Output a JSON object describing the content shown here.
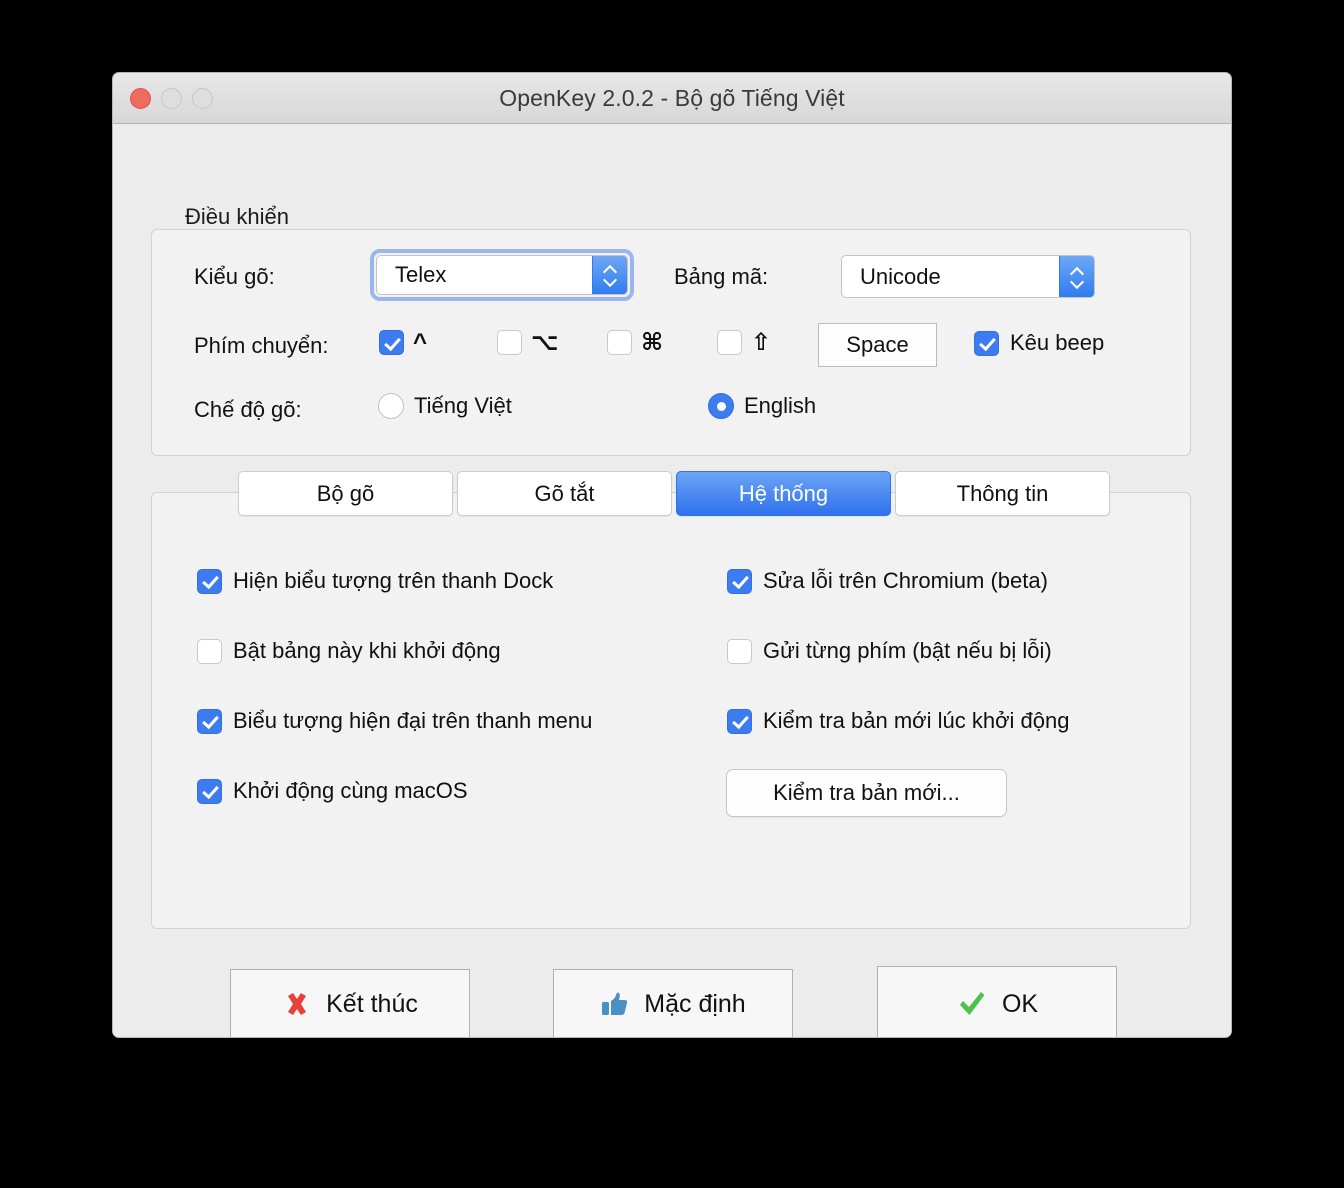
{
  "window": {
    "title": "OpenKey 2.0.2 - Bộ gõ Tiếng Việt",
    "traffic": {
      "close": "close-button",
      "minimize": "minimize-button",
      "maximize": "maximize-button"
    }
  },
  "control_group": {
    "legend": "Điều khiển",
    "input_method": {
      "label": "Kiểu gõ:",
      "value": "Telex",
      "focused": true
    },
    "charset": {
      "label": "Bảng mã:",
      "value": "Unicode",
      "focused": false
    },
    "switch_key": {
      "label": "Phím chuyển:",
      "modifiers": [
        {
          "glyph": "^",
          "name": "control-key",
          "checked": true
        },
        {
          "glyph": "⌥",
          "name": "option-key",
          "checked": false
        },
        {
          "glyph": "⌘",
          "name": "command-key",
          "checked": false
        },
        {
          "glyph": "⇧",
          "name": "shift-key",
          "checked": false
        }
      ],
      "space_button": "Space",
      "beep": {
        "label": "Kêu beep",
        "checked": true
      }
    },
    "typing_mode": {
      "label": "Chế độ gõ:",
      "options": [
        {
          "label": "Tiếng Việt",
          "selected": false
        },
        {
          "label": "English",
          "selected": true
        }
      ]
    }
  },
  "tabs": [
    {
      "label": "Bộ gõ",
      "selected": false
    },
    {
      "label": "Gõ tắt",
      "selected": false
    },
    {
      "label": "Hệ thống",
      "selected": true
    },
    {
      "label": "Thông tin",
      "selected": false
    }
  ],
  "system_tab": {
    "left_column": [
      {
        "label": "Hiện biểu tượng trên thanh Dock",
        "checked": true
      },
      {
        "label": "Bật bảng này khi khởi động",
        "checked": false
      },
      {
        "label": "Biểu tượng hiện đại trên thanh menu",
        "checked": true
      },
      {
        "label": "Khởi động cùng macOS",
        "checked": true
      }
    ],
    "right_column": [
      {
        "label": "Sửa lỗi trên Chromium (beta)",
        "checked": true
      },
      {
        "label": "Gửi từng phím (bật nếu bị lỗi)",
        "checked": false
      },
      {
        "label": "Kiểm tra bản mới lúc khởi động",
        "checked": true
      }
    ],
    "check_update_button": "Kiểm tra bản mới..."
  },
  "footer": {
    "quit": {
      "label": "Kết thúc",
      "icon": "red-x-icon"
    },
    "default": {
      "label": "Mặc định",
      "icon": "thumbs-up-icon"
    },
    "ok": {
      "label": "OK",
      "icon": "green-check-icon"
    }
  },
  "colors": {
    "accent_blue": "#3c7cf0",
    "focus_ring": "#9ab6ee",
    "red": "#e8403a",
    "green": "#4cc14c",
    "thumb_blue": "#4a90c2"
  }
}
